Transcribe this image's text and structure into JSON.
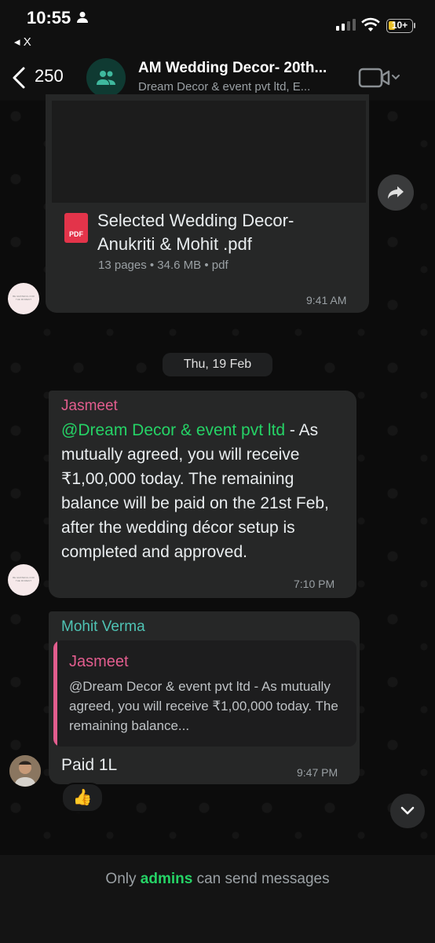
{
  "status_bar": {
    "time": "10:55",
    "back_app": "◂ X",
    "battery": "10+"
  },
  "header": {
    "back_count": "250",
    "title": "AM Wedding Decor- 20th...",
    "subtitle": "Dream Decor & event pvt ltd, E..."
  },
  "messages": {
    "pdf": {
      "file_name": "Selected Wedding Decor-Anukriti & Mohit .pdf",
      "meta": "13 pages • 34.6 MB • pdf",
      "time": "9:41 AM",
      "icon_label": "PDF"
    },
    "date_separator": "Thu, 19 Feb",
    "jasmeet": {
      "sender": "Jasmeet",
      "mention": "@Dream Decor & event pvt ltd",
      "text": " - As mutually agreed, you will receive ₹1,00,000 today. The remaining balance will be paid on the 21st Feb, after the wedding décor setup is completed and approved.",
      "time": "7:10 PM"
    },
    "mohit": {
      "sender": "Mohit Verma",
      "quote_sender": "Jasmeet",
      "quote_text": "@Dream Decor & event pvt ltd - As mutually agreed, you will receive ₹1,00,000 today. The remaining balance...",
      "text": "Paid 1L",
      "time": "9:47 PM",
      "reaction": "👍"
    }
  },
  "footer": {
    "prefix": "Only ",
    "admins": "admins",
    "suffix": " can send messages"
  },
  "colors": {
    "accent_green": "#25d366",
    "jasmeet_pink": "#e25d8e",
    "mohit_teal": "#4fc3b4"
  }
}
